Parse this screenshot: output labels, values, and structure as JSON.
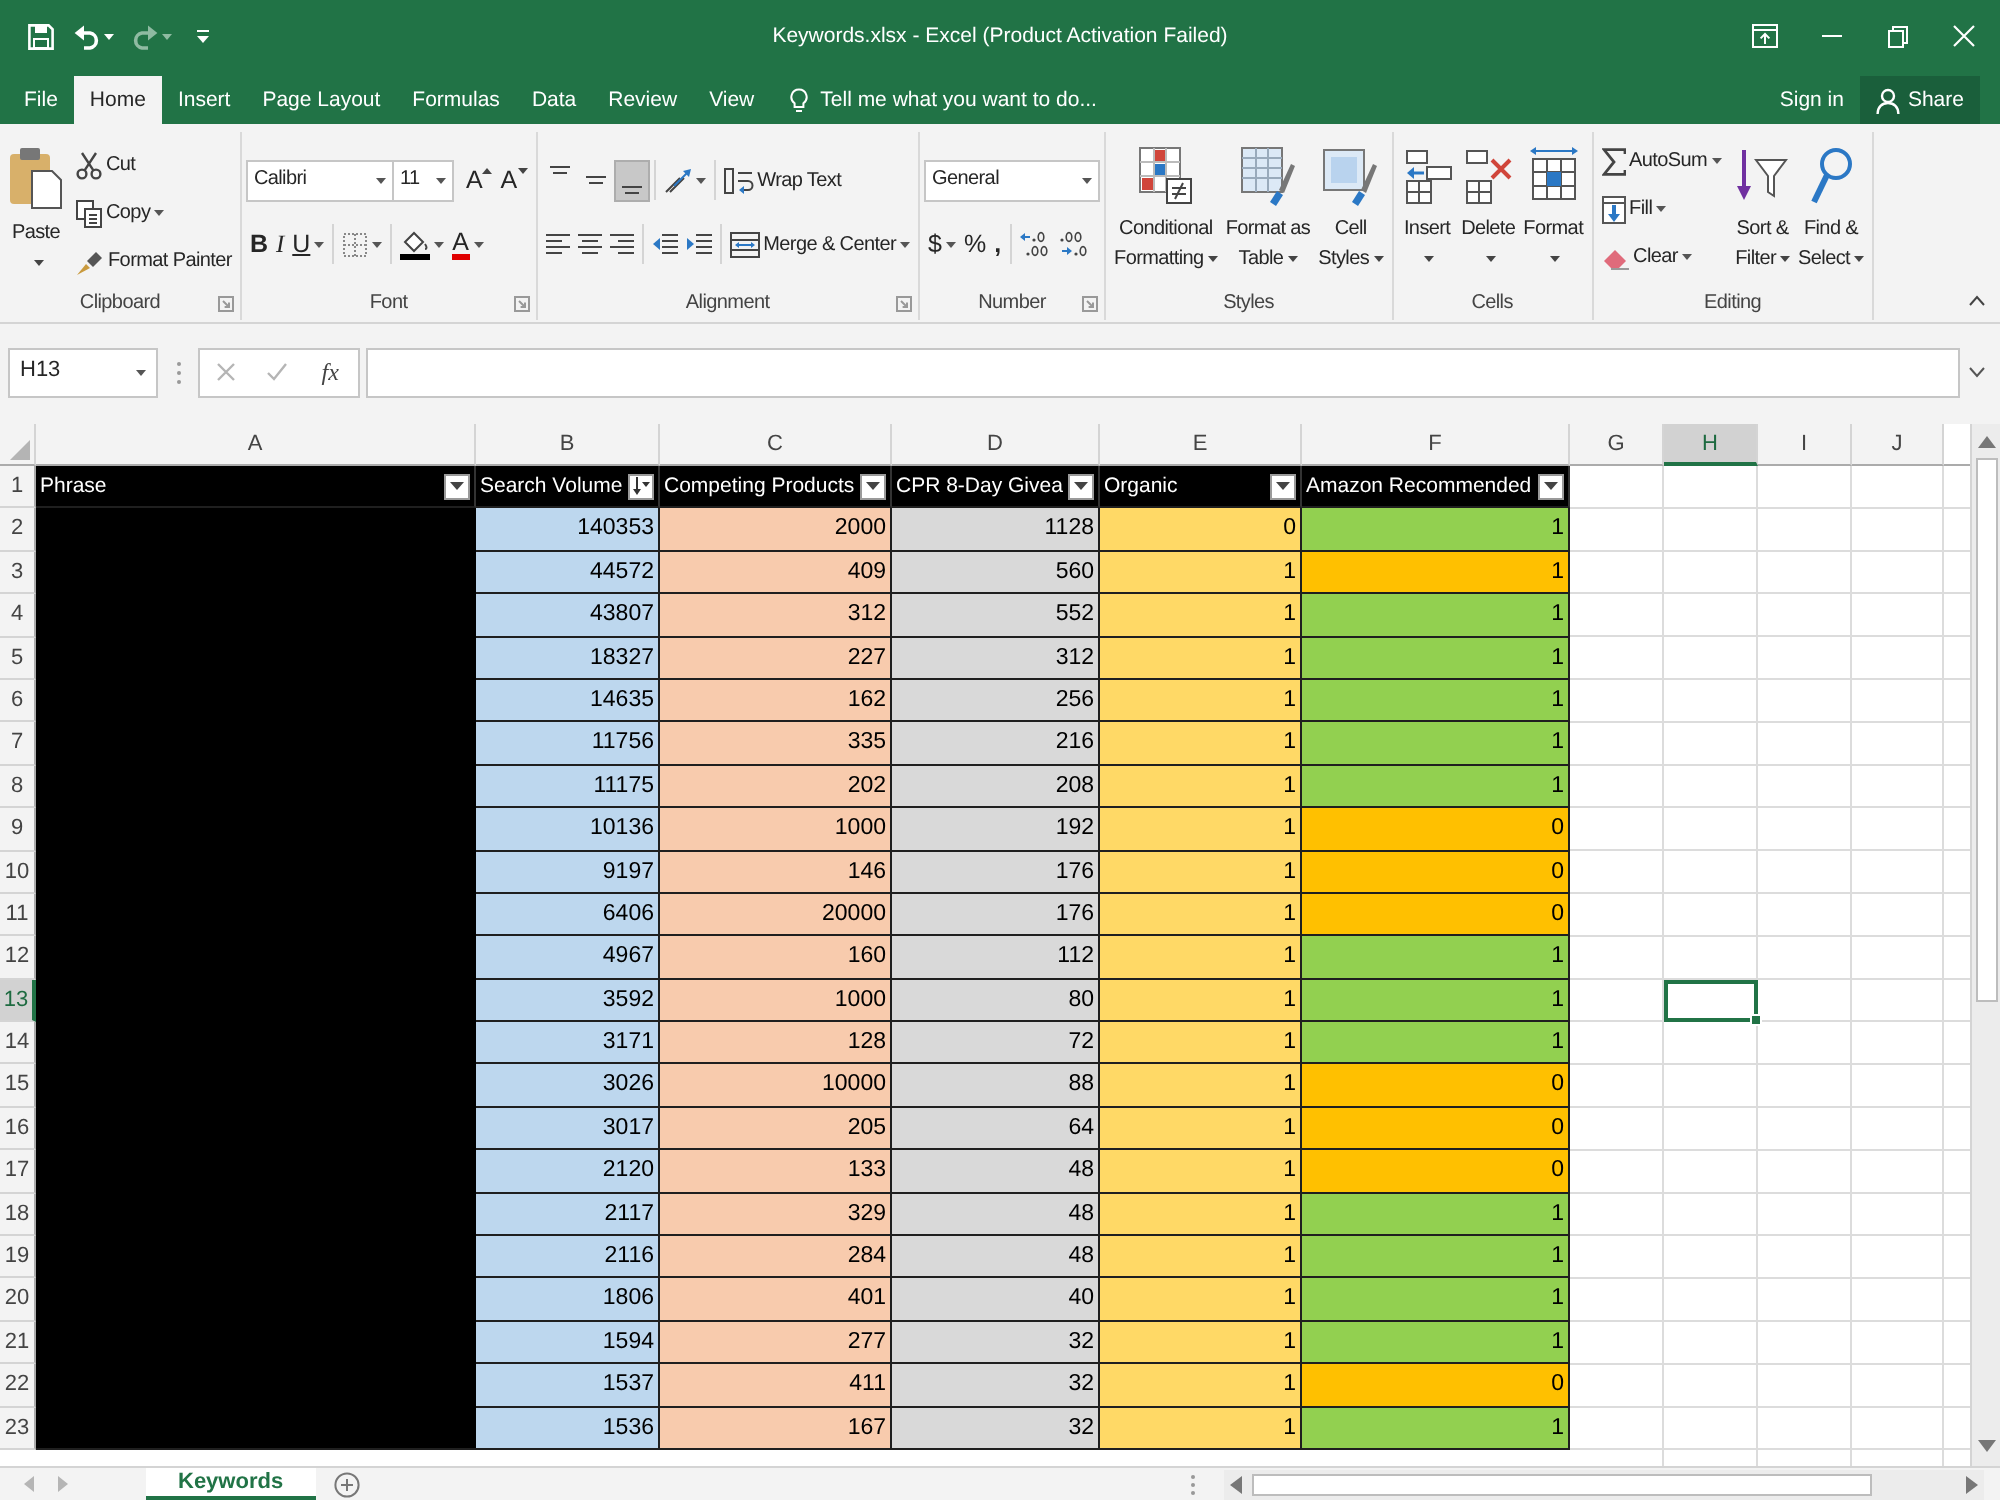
{
  "title_bar": {
    "title": "Keywords.xlsx - Excel (Product Activation Failed)",
    "undo": {
      "disabled": false
    },
    "redo": {
      "disabled": true
    }
  },
  "tabs": [
    {
      "label": "File",
      "selected": false
    },
    {
      "label": "Home",
      "selected": true
    },
    {
      "label": "Insert",
      "selected": false
    },
    {
      "label": "Page Layout",
      "selected": false
    },
    {
      "label": "Formulas",
      "selected": false
    },
    {
      "label": "Data",
      "selected": false
    },
    {
      "label": "Review",
      "selected": false
    },
    {
      "label": "View",
      "selected": false
    }
  ],
  "tell_me": {
    "placeholder": "Tell me what you want to do..."
  },
  "account": {
    "sign_in": "Sign in",
    "share": "Share"
  },
  "ribbon": {
    "clipboard": {
      "label": "Clipboard",
      "paste": "Paste",
      "cut": "Cut",
      "copy": "Copy",
      "format_painter": "Format Painter"
    },
    "font": {
      "label": "Font",
      "font_name": "Calibri",
      "font_size": "11",
      "grow_font": "A",
      "shrink_font": "A",
      "bold": "B",
      "italic": "I",
      "underline": "U",
      "font_color": "A"
    },
    "alignment": {
      "label": "Alignment",
      "vertical_align": [
        {
          "selected": false
        },
        {
          "selected": false
        },
        {
          "selected": true
        }
      ],
      "wrap_text": "Wrap Text",
      "merge": "Merge & Center"
    },
    "number": {
      "label": "Number",
      "format": "General",
      "currency": "$",
      "percent": "%",
      "comma": ","
    },
    "styles": {
      "label": "Styles",
      "buttons": [
        "Conditional Formatting",
        "Format as Table",
        "Cell Styles"
      ]
    },
    "cells": {
      "label": "Cells",
      "buttons": [
        "Insert",
        "Delete",
        "Format"
      ]
    },
    "editing": {
      "label": "Editing",
      "autosum": "AutoSum",
      "fill": "Fill",
      "clear": "Clear",
      "sort_filter": "Sort & Filter",
      "find_select": "Find & Select"
    }
  },
  "formula_bar": {
    "name_box": "H13",
    "cancel": {
      "disabled": true
    },
    "enter": {
      "disabled": true
    },
    "function_button": "fx"
  },
  "sheet": {
    "column_letters": [
      {
        "label": "A",
        "selected": false
      },
      {
        "label": "B",
        "selected": false
      },
      {
        "label": "C",
        "selected": false
      },
      {
        "label": "D",
        "selected": false
      },
      {
        "label": "E",
        "selected": false
      },
      {
        "label": "F",
        "selected": false
      },
      {
        "label": "G",
        "selected": false
      },
      {
        "label": "H",
        "selected": true
      },
      {
        "label": "I",
        "selected": false
      },
      {
        "label": "J",
        "selected": false
      }
    ],
    "header_row": {
      "number": "1",
      "selected": false
    },
    "table": {
      "columns": [
        {
          "header": "Phrase",
          "sorted": false,
          "color": "#000000"
        },
        {
          "header": "Search Volume",
          "sorted": true,
          "color": "#bdd7ee"
        },
        {
          "header": "Competing Products",
          "sorted": false,
          "color": "#f8cbad"
        },
        {
          "header": "CPR 8-Day Givea",
          "sorted": false,
          "color": "#d9d9d9"
        },
        {
          "header": "Organic",
          "sorted": false,
          "color": "#ffd966"
        },
        {
          "header": "Amazon Recommended",
          "sorted": false
        }
      ],
      "rows": [
        {
          "number": "2",
          "selected": false,
          "cells": [
            "140353",
            "2000",
            "1128",
            "0",
            "1"
          ],
          "color": "#92d050"
        },
        {
          "number": "3",
          "selected": false,
          "cells": [
            "44572",
            "409",
            "560",
            "1",
            "1"
          ],
          "color": "#ffc000"
        },
        {
          "number": "4",
          "selected": false,
          "cells": [
            "43807",
            "312",
            "552",
            "1",
            "1"
          ],
          "color": "#92d050"
        },
        {
          "number": "5",
          "selected": false,
          "cells": [
            "18327",
            "227",
            "312",
            "1",
            "1"
          ],
          "color": "#92d050"
        },
        {
          "number": "6",
          "selected": false,
          "cells": [
            "14635",
            "162",
            "256",
            "1",
            "1"
          ],
          "color": "#92d050"
        },
        {
          "number": "7",
          "selected": false,
          "cells": [
            "11756",
            "335",
            "216",
            "1",
            "1"
          ],
          "color": "#92d050"
        },
        {
          "number": "8",
          "selected": false,
          "cells": [
            "11175",
            "202",
            "208",
            "1",
            "1"
          ],
          "color": "#92d050"
        },
        {
          "number": "9",
          "selected": false,
          "cells": [
            "10136",
            "1000",
            "192",
            "1",
            "0"
          ],
          "color": "#ffc000"
        },
        {
          "number": "10",
          "selected": false,
          "cells": [
            "9197",
            "146",
            "176",
            "1",
            "0"
          ],
          "color": "#ffc000"
        },
        {
          "number": "11",
          "selected": false,
          "cells": [
            "6406",
            "20000",
            "176",
            "1",
            "0"
          ],
          "color": "#ffc000"
        },
        {
          "number": "12",
          "selected": false,
          "cells": [
            "4967",
            "160",
            "112",
            "1",
            "1"
          ],
          "color": "#92d050"
        },
        {
          "number": "13",
          "selected": true,
          "cells": [
            "3592",
            "1000",
            "80",
            "1",
            "1"
          ],
          "color": "#92d050"
        },
        {
          "number": "14",
          "selected": false,
          "cells": [
            "3171",
            "128",
            "72",
            "1",
            "1"
          ],
          "color": "#92d050"
        },
        {
          "number": "15",
          "selected": false,
          "cells": [
            "3026",
            "10000",
            "88",
            "1",
            "0"
          ],
          "color": "#ffc000"
        },
        {
          "number": "16",
          "selected": false,
          "cells": [
            "3017",
            "205",
            "64",
            "1",
            "0"
          ],
          "color": "#ffc000"
        },
        {
          "number": "17",
          "selected": false,
          "cells": [
            "2120",
            "133",
            "48",
            "1",
            "0"
          ],
          "color": "#ffc000"
        },
        {
          "number": "18",
          "selected": false,
          "cells": [
            "2117",
            "329",
            "48",
            "1",
            "1"
          ],
          "color": "#92d050"
        },
        {
          "number": "19",
          "selected": false,
          "cells": [
            "2116",
            "284",
            "48",
            "1",
            "1"
          ],
          "color": "#92d050"
        },
        {
          "number": "20",
          "selected": false,
          "cells": [
            "1806",
            "401",
            "40",
            "1",
            "1"
          ],
          "color": "#92d050"
        },
        {
          "number": "21",
          "selected": false,
          "cells": [
            "1594",
            "277",
            "32",
            "1",
            "1"
          ],
          "color": "#92d050"
        },
        {
          "number": "22",
          "selected": false,
          "cells": [
            "1537",
            "411",
            "32",
            "1",
            "0"
          ],
          "color": "#ffc000"
        },
        {
          "number": "23",
          "selected": false,
          "cells": [
            "1536",
            "167",
            "32",
            "1",
            "1"
          ],
          "color": "#92d050"
        }
      ]
    }
  },
  "sheet_tabs": [
    {
      "label": "Keywords",
      "selected": true
    }
  ]
}
